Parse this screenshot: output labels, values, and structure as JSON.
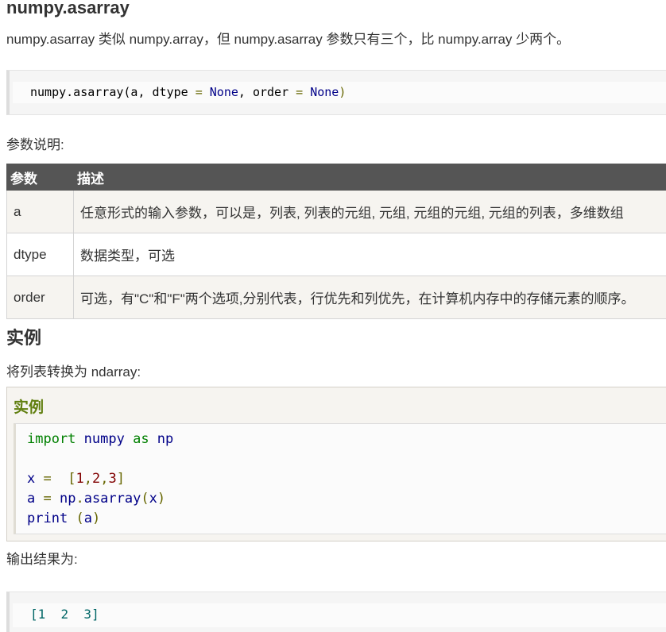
{
  "heading": "numpy.asarray",
  "intro": "numpy.asarray 类似 numpy.array，但 numpy.asarray 参数只有三个，比 numpy.array 少两个。",
  "signature": {
    "fn": "numpy.asarray(a, dtype ",
    "eq1": "=",
    "none1": "None",
    "mid": ", order ",
    "eq2": "=",
    "none2": "None",
    "close": ")"
  },
  "params_label": "参数说明:",
  "params_table": {
    "headers": [
      "参数",
      "描述"
    ],
    "rows": [
      [
        "a",
        "任意形式的输入参数，可以是，列表, 列表的元组, 元组, 元组的元组, 元组的列表，多维数组"
      ],
      [
        "dtype",
        "数据类型，可选"
      ],
      [
        "order",
        "可选，有\"C\"和\"F\"两个选项,分别代表，行优先和列优先，在计算机内存中的存储元素的顺序。"
      ]
    ]
  },
  "example_heading": "实例",
  "example_desc": "将列表转换为 ndarray:",
  "example_box_title": "实例",
  "example_code": {
    "l1_kw": "import",
    "l1_rest": " numpy ",
    "l1_as": "as",
    "l1_np": " np",
    "l3_x": "x ",
    "l3_eq": "=",
    "l3_sp": "  ",
    "l3_lb": "[",
    "l3_1": "1",
    "l3_c1": ",",
    "l3_2": "2",
    "l3_c2": ",",
    "l3_3": "3",
    "l3_rb": "]",
    "l4_a": "a ",
    "l4_eq": "=",
    "l4_call": " np",
    "l4_dot": ".",
    "l4_fn": "asarray",
    "l4_lp": "(",
    "l4_x": "x",
    "l4_rp": ")",
    "l5_print": "print",
    "l5_sp": " ",
    "l5_lp": "(",
    "l5_a": "a",
    "l5_rp": ")"
  },
  "output_label": "输出结果为:",
  "output_code": "[1  2  3]",
  "colors": {
    "table_header_bg": "#555555",
    "example_title": "#617f10",
    "keyword": "#008000",
    "identifier": "#000088",
    "number": "#800000"
  }
}
